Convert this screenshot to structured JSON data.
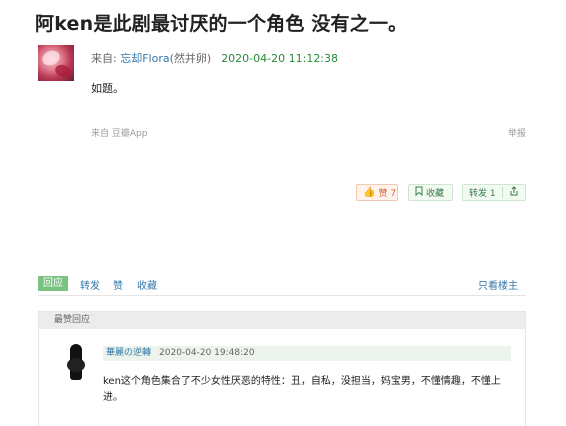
{
  "post": {
    "title": "阿ken是此剧最讨厌的一个角色 没有之一。",
    "from_label": "来自: ",
    "author": "忘却Flora",
    "author_sub": "(然并卵)",
    "time": "2020-04-20 11:12:38",
    "body": "如题。",
    "source": "来自 豆瓣App",
    "report": "举报"
  },
  "buttons": {
    "like": "赞 7",
    "collect": "收藏",
    "share": "转发 1"
  },
  "icons": {
    "like": "thumbs-up-icon",
    "collect": "bookmark-icon",
    "share": "share-icon"
  },
  "actions": {
    "reply": "回应",
    "forward": "转发",
    "like": "赞",
    "favorite": "收藏",
    "owner_only": "只看楼主"
  },
  "best_replies": {
    "header": "最赞回应",
    "items": [
      {
        "author": "華麗の逆轉",
        "time": "2020-04-20 19:48:20",
        "text": "ken这个角色集合了不少女性厌恶的特性：丑，自私，没担当，妈宝男，不懂情趣，不懂上进。"
      }
    ]
  },
  "colors": {
    "link": "#3377aa",
    "time_green": "#2a8a3a",
    "reply_button": "#7ac27f",
    "like_orange": "#d2663a"
  }
}
